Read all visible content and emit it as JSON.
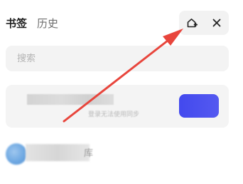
{
  "tabs": [
    {
      "label": "书签",
      "active": true
    },
    {
      "label": "历史",
      "active": false
    }
  ],
  "toolbar": {
    "add_bookmark_icon": "home-plus-icon",
    "close_icon": "close-icon"
  },
  "search": {
    "placeholder": "搜索",
    "value": ""
  },
  "login_card": {
    "note": "登录无法使用同步"
  },
  "account": {
    "suffix": "库"
  },
  "colors": {
    "annotation_arrow": "#e8453c",
    "login_button": "#4a4ff0"
  }
}
